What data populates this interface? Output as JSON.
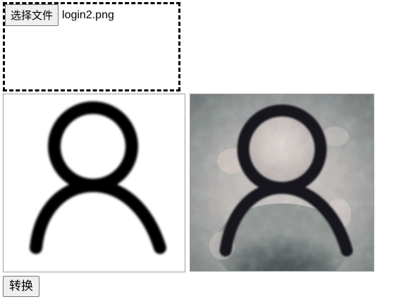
{
  "file_input": {
    "button_label": "选择文件",
    "file_name": "login2.png"
  },
  "images": {
    "input_icon": "user-icon",
    "output_icon": "user-icon-stylized"
  },
  "actions": {
    "convert_label": "转换"
  },
  "colors": {
    "dash_border": "#000000",
    "button_bg": "#efefef",
    "button_border": "#767676",
    "image_border": "#a0a0a0"
  }
}
